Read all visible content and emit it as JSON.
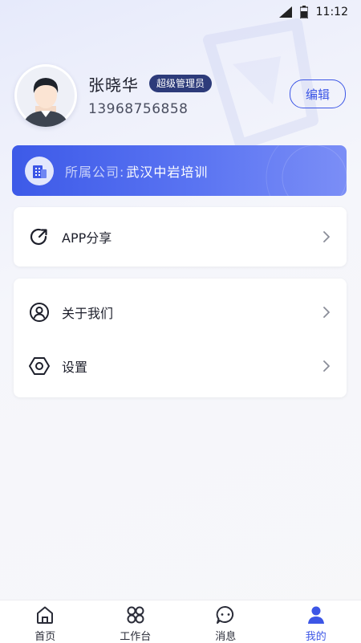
{
  "status_bar": {
    "time": "11:12"
  },
  "profile": {
    "name": "张晓华",
    "role": "超级管理员",
    "phone": "13968756858",
    "edit_label": "编辑"
  },
  "company": {
    "label": "所属公司:",
    "name": "武汉中岩培训"
  },
  "menu_group_1": [
    {
      "label": "APP分享",
      "icon": "share-icon"
    }
  ],
  "menu_group_2": [
    {
      "label": "关于我们",
      "icon": "person-circle-icon"
    },
    {
      "label": "设置",
      "icon": "settings-hexagon-icon"
    }
  ],
  "tabs": [
    {
      "label": "首页",
      "icon": "home-icon",
      "active": false
    },
    {
      "label": "工作台",
      "icon": "workbench-icon",
      "active": false
    },
    {
      "label": "消息",
      "icon": "message-icon",
      "active": false
    },
    {
      "label": "我的",
      "icon": "profile-icon",
      "active": true
    }
  ],
  "colors": {
    "accent": "#3c56e6",
    "badge": "#2d3b7a"
  }
}
